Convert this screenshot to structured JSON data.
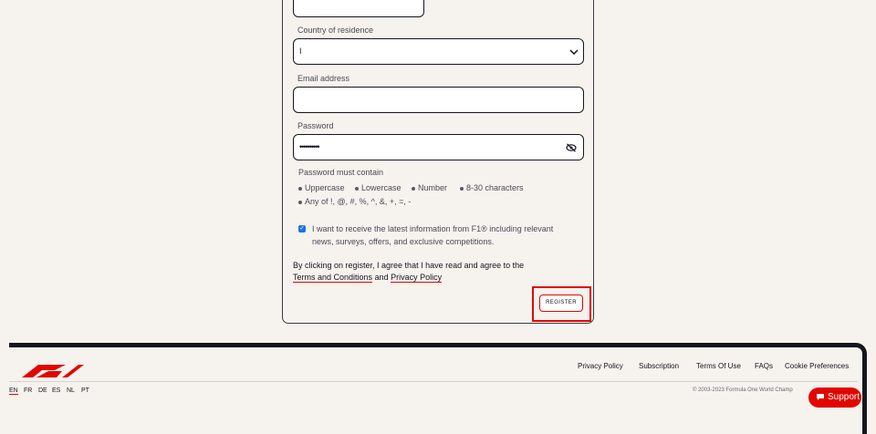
{
  "form": {
    "country_label": "Country of residence",
    "country_value": "I",
    "email_label": "Email address",
    "email_value": "",
    "password_label": "Password",
    "password_value": "••••••••••",
    "rules_title": "Password must contain",
    "rules": [
      "Uppercase",
      "Lowercase",
      "Number",
      "8-30 characters"
    ],
    "rules_special": "Any of !, @, #, %, ^, &, +, =, -",
    "opt_in_line1": "I want to receive the latest information from F1® including relevant",
    "opt_in_line2": "news, surveys, offers, and exclusive competitions.",
    "opt_in_checked": true,
    "consent_text": "By clicking on register, I agree that I have read and agree to the",
    "terms_link": "Terms and Conditions",
    "and_text": "and",
    "privacy_link": "Privacy Policy",
    "register_label": "REGISTER"
  },
  "footer": {
    "links": [
      "Privacy Policy",
      "Subscription",
      "Terms Of Use",
      "FAQs",
      "Cookie Preferences"
    ],
    "languages": [
      "EN",
      "FR",
      "DE",
      "ES",
      "NL",
      "PT"
    ],
    "active_language": "EN",
    "copyright": "© 2003-2023 Formula One World Champ",
    "support_label": "Support"
  },
  "colors": {
    "accent": "#e10600",
    "text": "#15151e",
    "background": "#f6f2ee",
    "checkbox": "#1a73e8"
  },
  "icons": {
    "country_dropdown": "chevron-down-icon",
    "password_toggle": "eye-slash-icon",
    "support": "chat-bubble-icon",
    "logo": "f1-logo-icon"
  }
}
